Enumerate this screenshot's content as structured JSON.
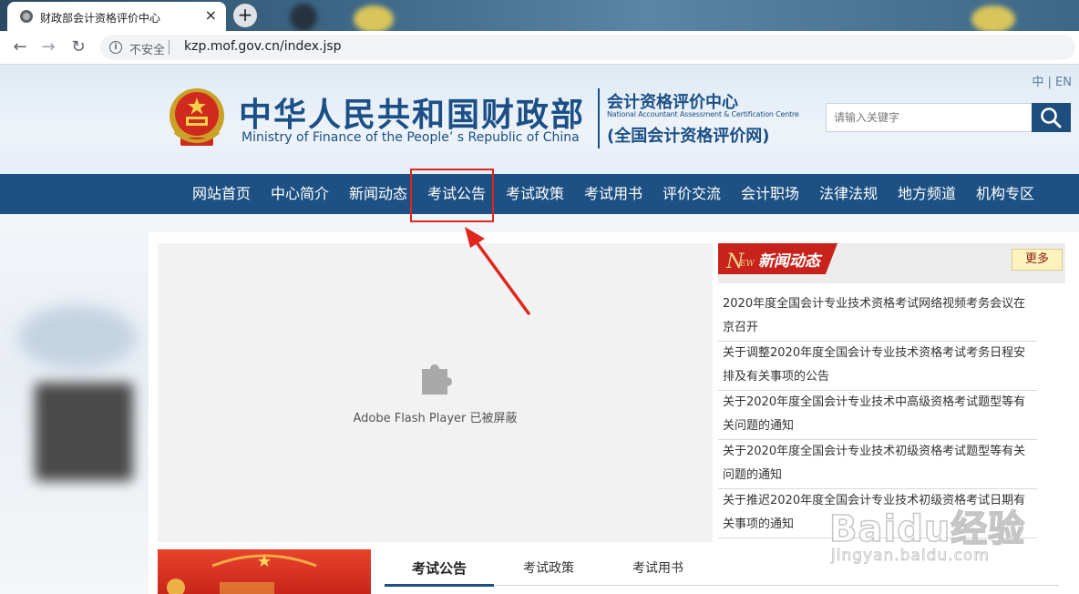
{
  "browser": {
    "tab_title": "财政部会计资格评价中心",
    "tab_close": "×",
    "new_tab": "+",
    "back": "←",
    "forward": "→",
    "reload": "↻",
    "security_label": "不安全",
    "url": "kzp.mof.gov.cn/index.jsp"
  },
  "header": {
    "lang_switch": "中 | EN",
    "title_cn": "中华人民共和国财政部",
    "title_en": "Ministry of Finance of the People’ s Republic of China",
    "center_cn": "会计资格评价中心",
    "center_en": "National Accountant Assessment & Certification Centre",
    "center_sub": "(全国会计资格评价网)",
    "search_placeholder": "请输入关键字"
  },
  "nav": {
    "items": [
      "网站首页",
      "中心简介",
      "新闻动态",
      "考试公告",
      "考试政策",
      "考试用书",
      "评价交流",
      "会计职场",
      "法律法规",
      "地方频道",
      "机构专区"
    ],
    "highlighted_index": 3
  },
  "flash": {
    "message": "Adobe Flash Player 已被屏蔽"
  },
  "news": {
    "tag_letter": "N",
    "tag_rest": "EW",
    "title": "新闻动态",
    "more": "更多",
    "items": [
      "2020年度全国会计专业技术资格考试网络视频考务会议在京召开",
      "关于调整2020年度全国会计专业技术资格考试考务日程安排及有关事项的公告",
      "关于2020年度全国会计专业技术中高级资格考试题型等有关问题的通知",
      "关于2020年度全国会计专业技术初级资格考试题型等有关问题的通知",
      "关于推迟2020年度全国会计专业技术初级资格考试日期有关事项的通知"
    ]
  },
  "exam_tabs": [
    "考试公告",
    "考试政策",
    "考试用书"
  ],
  "watermark": {
    "logo": "Baidu经验",
    "url": "jingyan.baidu.com"
  },
  "colors": {
    "nav_bg": "#1d5183",
    "title_blue": "#1b4f86",
    "highlight_red": "#e0261d",
    "news_red": "#c7231c"
  }
}
